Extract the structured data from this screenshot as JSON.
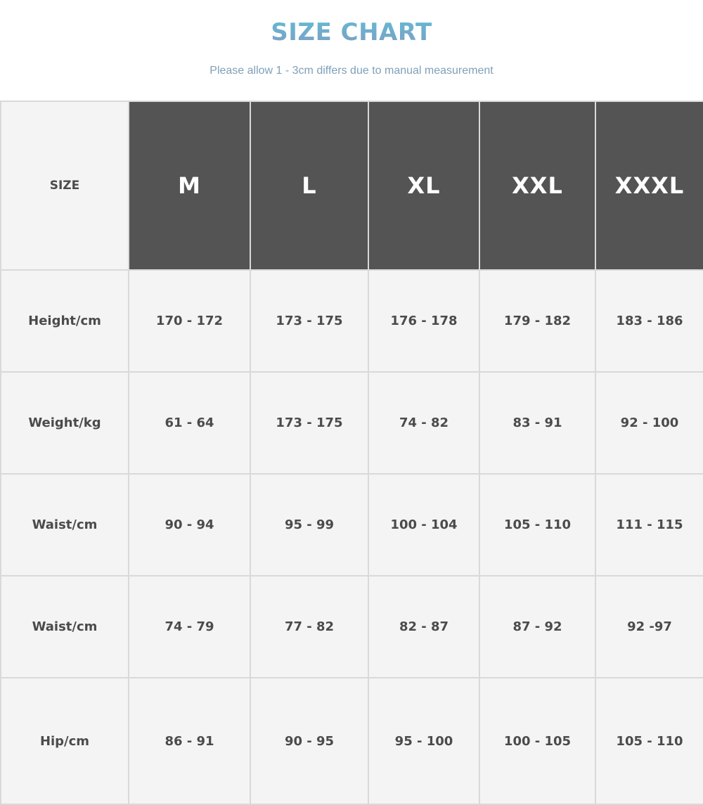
{
  "header": {
    "title": "SIZE CHART",
    "subtitle": "Please allow 1 - 3cm differs due to manual measurement"
  },
  "colors": {
    "title_gradient_top": "#63bad4",
    "title_gradient_bottom": "#7e9ec4",
    "subtitle": "#7f9fb9",
    "header_cell_bg": "#545454",
    "cell_bg": "#f4f4f4",
    "grid_line": "#d9d9d9",
    "text": "#4b4b4b"
  },
  "table": {
    "corner_label": "SIZE",
    "sizes": [
      "M",
      "L",
      "XL",
      "XXL",
      "XXXL"
    ],
    "rows": [
      {
        "label": "Height/cm",
        "values": [
          "170 - 172",
          "173 - 175",
          "176 - 178",
          "179 - 182",
          "183 - 186"
        ]
      },
      {
        "label": "Weight/kg",
        "values": [
          "61 - 64",
          "173 - 175",
          "74 - 82",
          "83 - 91",
          "92 - 100"
        ]
      },
      {
        "label": "Waist/cm",
        "values": [
          "90 - 94",
          "95 - 99",
          "100 - 104",
          "105 - 110",
          "111 - 115"
        ]
      },
      {
        "label": "Waist/cm",
        "values": [
          "74 - 79",
          "77 - 82",
          "82 - 87",
          "87 - 92",
          "92  -97"
        ]
      },
      {
        "label": "Hip/cm",
        "values": [
          "86 - 91",
          "90 - 95",
          "95 - 100",
          "100 - 105",
          "105 - 110"
        ]
      }
    ]
  }
}
